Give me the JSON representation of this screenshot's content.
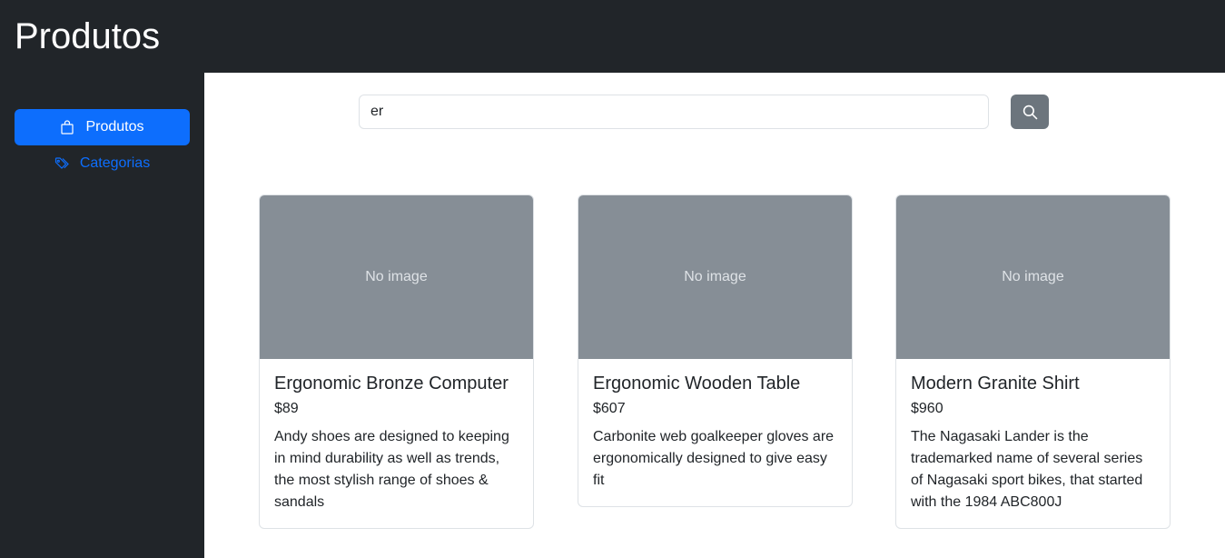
{
  "header": {
    "title": "Produtos"
  },
  "sidebar": {
    "items": [
      {
        "label": "Produtos",
        "icon": "bag-icon",
        "active": true
      },
      {
        "label": "Categorias",
        "icon": "tags-icon",
        "active": false
      }
    ]
  },
  "search": {
    "value": "er",
    "button_icon": "search-icon"
  },
  "products": [
    {
      "image_text": "No image",
      "name": "Ergonomic Bronze Computer",
      "price": "$89",
      "description": "Andy shoes are designed to keeping in mind durability as well as trends, the most stylish range of shoes & sandals"
    },
    {
      "image_text": "No image",
      "name": "Ergonomic Wooden Table",
      "price": "$607",
      "description": "Carbonite web goalkeeper gloves are ergonomically designed to give easy fit"
    },
    {
      "image_text": "No image",
      "name": "Modern Granite Shirt",
      "price": "$960",
      "description": "The Nagasaki Lander is the trademarked name of several series of Nagasaki sport bikes, that started with the 1984 ABC800J"
    }
  ],
  "colors": {
    "dark": "#212529",
    "primary": "#0d6efd",
    "secondary": "#6c757d",
    "placeholder": "#868e96"
  }
}
